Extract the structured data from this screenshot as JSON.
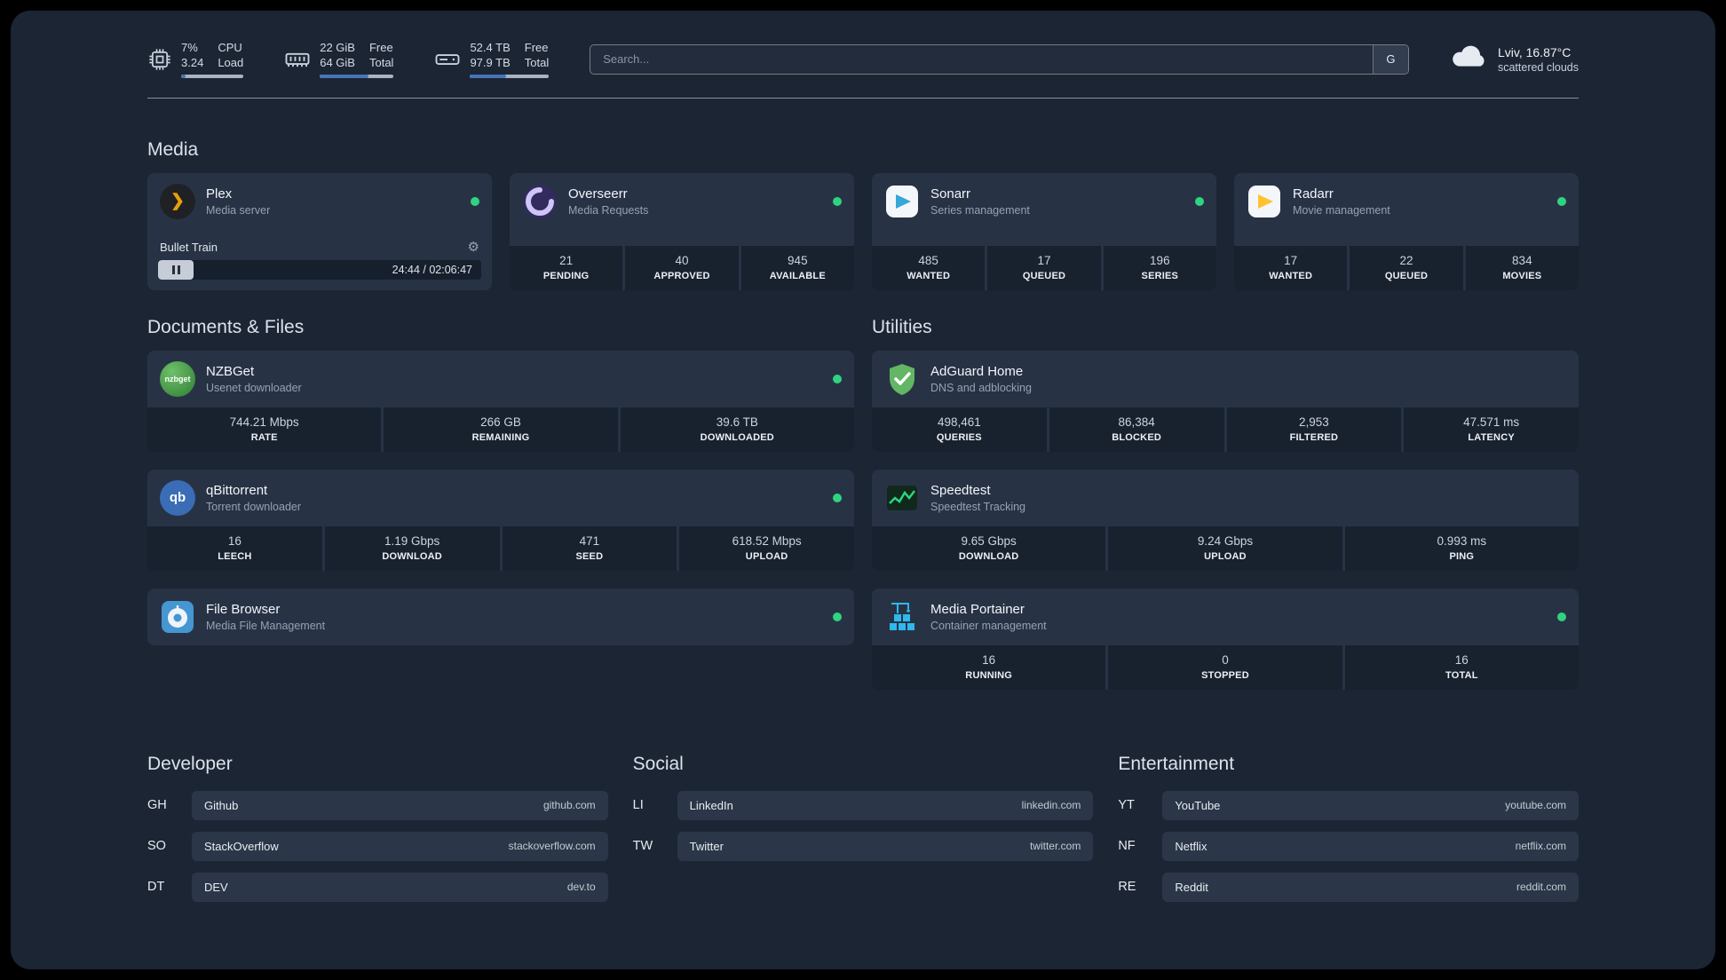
{
  "topbar": {
    "resources": [
      {
        "icon": "cpu-icon",
        "primary": [
          "7%",
          "3.24"
        ],
        "secondary": [
          "CPU",
          "Load"
        ],
        "bar_pct": 7
      },
      {
        "icon": "memory-icon",
        "primary": [
          "22 GiB",
          "64 GiB"
        ],
        "secondary": [
          "Free",
          "Total"
        ],
        "bar_pct": 66
      },
      {
        "icon": "disk-icon",
        "primary": [
          "52.4 TB",
          "97.9 TB"
        ],
        "secondary": [
          "Free",
          "Total"
        ],
        "bar_pct": 46
      }
    ],
    "search": {
      "placeholder": "Search...",
      "provider_label": "G"
    },
    "weather": {
      "icon": "cloud-icon",
      "location": "Lviv, 16.87°C",
      "condition": "scattered clouds"
    }
  },
  "sections": {
    "media": {
      "title": "Media",
      "cards": {
        "plex": {
          "name": "Plex",
          "description": "Media server",
          "status": "online",
          "icon_glyph": "❯",
          "player": {
            "title": "Bullet Train",
            "time": "24:44 / 02:06:47"
          }
        },
        "overseerr": {
          "name": "Overseerr",
          "description": "Media Requests",
          "status": "online",
          "stats": [
            {
              "value": "21",
              "label": "PENDING"
            },
            {
              "value": "40",
              "label": "APPROVED"
            },
            {
              "value": "945",
              "label": "AVAILABLE"
            }
          ]
        },
        "sonarr": {
          "name": "Sonarr",
          "description": "Series management",
          "status": "online",
          "stats": [
            {
              "value": "485",
              "label": "WANTED"
            },
            {
              "value": "17",
              "label": "QUEUED"
            },
            {
              "value": "196",
              "label": "SERIES"
            }
          ]
        },
        "radarr": {
          "name": "Radarr",
          "description": "Movie management",
          "status": "online",
          "stats": [
            {
              "value": "17",
              "label": "WANTED"
            },
            {
              "value": "22",
              "label": "QUEUED"
            },
            {
              "value": "834",
              "label": "MOVIES"
            }
          ]
        }
      }
    },
    "documents": {
      "title": "Documents & Files",
      "cards": {
        "nzbget": {
          "name": "NZBGet",
          "description": "Usenet downloader",
          "status": "online",
          "icon_text": "nzbget",
          "stats": [
            {
              "value": "744.21 Mbps",
              "label": "RATE"
            },
            {
              "value": "266 GB",
              "label": "REMAINING"
            },
            {
              "value": "39.6 TB",
              "label": "DOWNLOADED"
            }
          ]
        },
        "qbittorrent": {
          "name": "qBittorrent",
          "description": "Torrent downloader",
          "status": "online",
          "icon_text": "qb",
          "stats": [
            {
              "value": "16",
              "label": "LEECH"
            },
            {
              "value": "1.19 Gbps",
              "label": "DOWNLOAD"
            },
            {
              "value": "471",
              "label": "SEED"
            },
            {
              "value": "618.52 Mbps",
              "label": "UPLOAD"
            }
          ]
        },
        "filebrowser": {
          "name": "File Browser",
          "description": "Media File Management",
          "status": "online"
        }
      }
    },
    "utilities": {
      "title": "Utilities",
      "cards": {
        "adguard": {
          "name": "AdGuard Home",
          "description": "DNS and adblocking",
          "stats": [
            {
              "value": "498,461",
              "label": "QUERIES"
            },
            {
              "value": "86,384",
              "label": "BLOCKED"
            },
            {
              "value": "2,953",
              "label": "FILTERED"
            },
            {
              "value": "47.571 ms",
              "label": "LATENCY"
            }
          ]
        },
        "speedtest": {
          "name": "Speedtest",
          "description": "Speedtest Tracking",
          "stats": [
            {
              "value": "9.65 Gbps",
              "label": "DOWNLOAD"
            },
            {
              "value": "9.24 Gbps",
              "label": "UPLOAD"
            },
            {
              "value": "0.993 ms",
              "label": "PING"
            }
          ]
        },
        "portainer": {
          "name": "Media Portainer",
          "description": "Container management",
          "status": "online",
          "stats": [
            {
              "value": "16",
              "label": "RUNNING"
            },
            {
              "value": "0",
              "label": "STOPPED"
            },
            {
              "value": "16",
              "label": "TOTAL"
            }
          ]
        }
      }
    }
  },
  "bookmarks": [
    {
      "title": "Developer",
      "items": [
        {
          "abbr": "GH",
          "name": "Github",
          "domain": "github.com"
        },
        {
          "abbr": "SO",
          "name": "StackOverflow",
          "domain": "stackoverflow.com"
        },
        {
          "abbr": "DT",
          "name": "DEV",
          "domain": "dev.to"
        }
      ]
    },
    {
      "title": "Social",
      "items": [
        {
          "abbr": "LI",
          "name": "LinkedIn",
          "domain": "linkedin.com"
        },
        {
          "abbr": "TW",
          "name": "Twitter",
          "domain": "twitter.com"
        }
      ]
    },
    {
      "title": "Entertainment",
      "items": [
        {
          "abbr": "YT",
          "name": "YouTube",
          "domain": "youtube.com"
        },
        {
          "abbr": "NF",
          "name": "Netflix",
          "domain": "netflix.com"
        },
        {
          "abbr": "RE",
          "name": "Reddit",
          "domain": "reddit.com"
        }
      ]
    }
  ],
  "colors": {
    "status_online": "#2fd47f",
    "accent_blue": "#4576b5",
    "background": "#1c2534",
    "card": "#273345"
  }
}
